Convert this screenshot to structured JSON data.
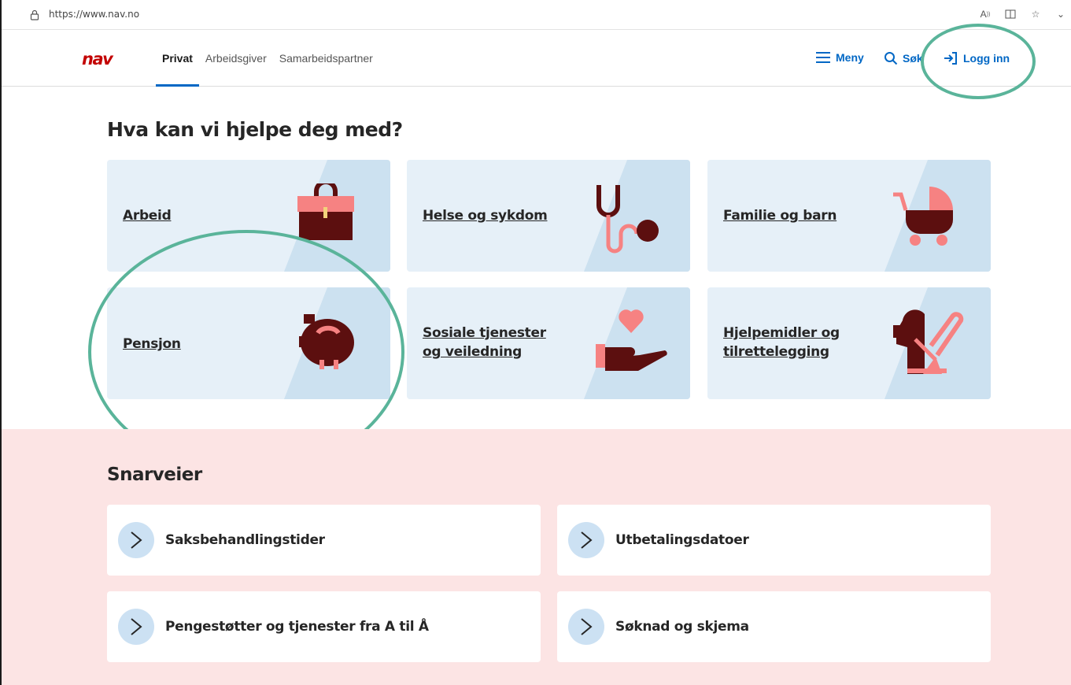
{
  "browser": {
    "url": "https://www.nav.no"
  },
  "header": {
    "tabs": [
      {
        "label": "Privat"
      },
      {
        "label": "Arbeidsgiver"
      },
      {
        "label": "Samarbeidspartner"
      }
    ],
    "menu_label": "Meny",
    "search_label": "Søk",
    "login_label": "Logg inn"
  },
  "main": {
    "heading": "Hva kan vi hjelpe deg med?",
    "cards": [
      {
        "label": "Arbeid",
        "icon": "briefcase-icon"
      },
      {
        "label": "Helse og sykdom",
        "icon": "stethoscope-icon"
      },
      {
        "label": "Familie og barn",
        "icon": "stroller-icon"
      },
      {
        "label": "Pensjon",
        "icon": "piggy-bank-icon"
      },
      {
        "label": "Sosiale tjenester\nog veiledning",
        "icon": "heart-hand-icon"
      },
      {
        "label": "Hjelpemidler og\ntilrettelegging",
        "icon": "guide-dog-icon"
      }
    ]
  },
  "shortcuts": {
    "heading": "Snarveier",
    "items": [
      {
        "label": "Saksbehandlingstider"
      },
      {
        "label": "Utbetalingsdatoer"
      },
      {
        "label": "Pengestøtter og tjenester fra A til Å"
      },
      {
        "label": "Søknad og skjema"
      }
    ]
  },
  "colors": {
    "brand_red": "#c30000",
    "link_blue": "#0067c5",
    "card_bg": "#e6f0f8",
    "shortcut_bg": "#fce4e4",
    "annotation_green": "#5ab49a",
    "icon_dark": "#5c0f0f",
    "icon_pink": "#f68282"
  }
}
